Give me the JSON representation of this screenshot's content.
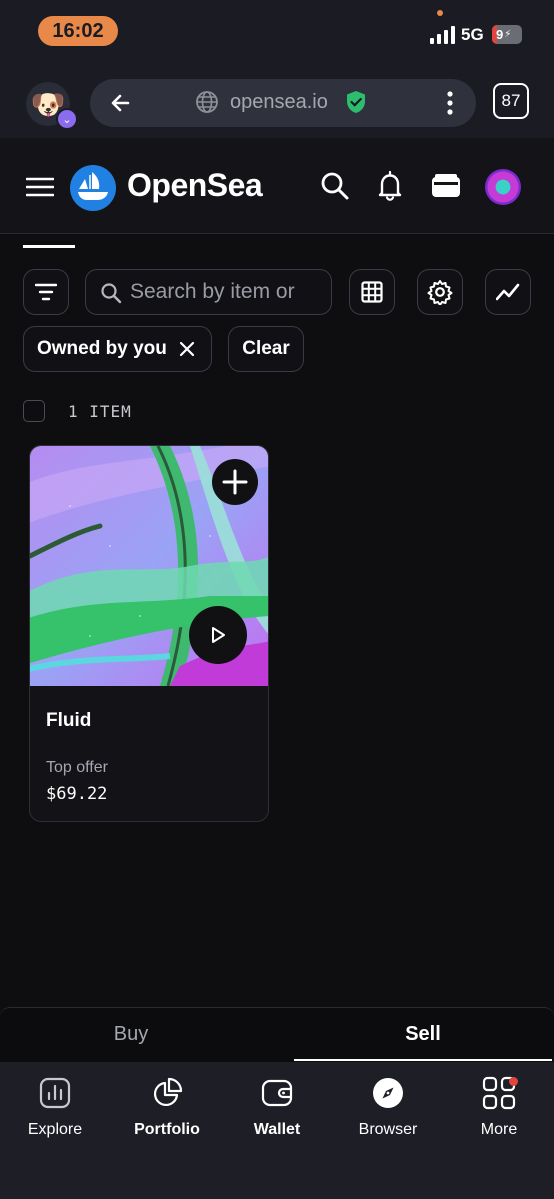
{
  "status_bar": {
    "time": "16:02",
    "network": "5G",
    "battery": "9"
  },
  "browser": {
    "url": "opensea.io",
    "tab_count": "87"
  },
  "header": {
    "brand": "OpenSea"
  },
  "search": {
    "placeholder": "Search by item or"
  },
  "filters": {
    "chip_owned": "Owned by you",
    "clear": "Clear"
  },
  "results": {
    "count_label": "1 ITEM"
  },
  "item": {
    "name": "Fluid",
    "offer_label": "Top offer",
    "offer_value": "$69.22"
  },
  "trade_tabs": {
    "buy": "Buy",
    "sell": "Sell",
    "active": "Sell"
  },
  "nav": [
    {
      "label": "Explore",
      "icon": "chart-icon"
    },
    {
      "label": "Portfolio",
      "icon": "pie-icon"
    },
    {
      "label": "Wallet",
      "icon": "wallet-icon"
    },
    {
      "label": "Browser",
      "icon": "compass-icon"
    },
    {
      "label": "More",
      "icon": "grid-icon"
    }
  ],
  "colors": {
    "accent": "#2081e2",
    "time_pill": "#e8894a",
    "secure": "#2dbd6e",
    "badge": "#e0463e"
  }
}
